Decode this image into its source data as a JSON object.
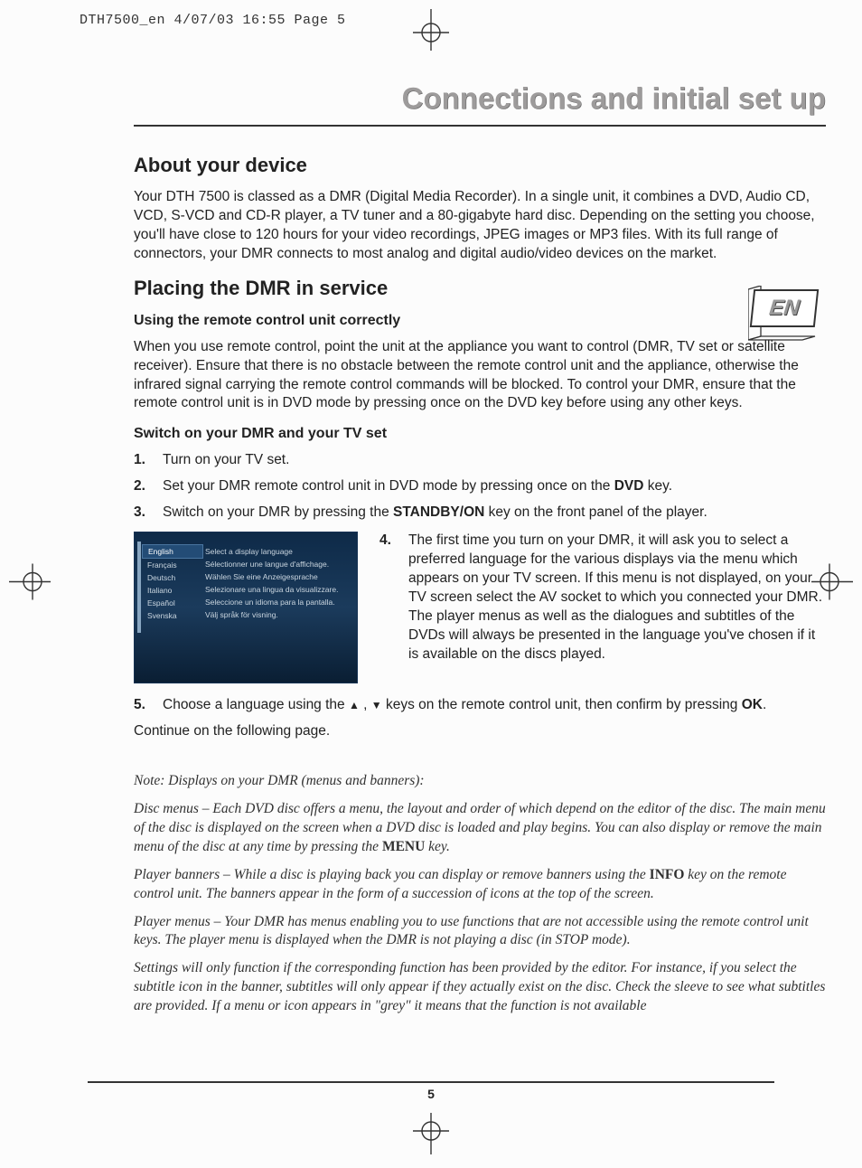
{
  "crop_header": "DTH7500_en  4/07/03  16:55  Page 5",
  "page_title": "Connections and initial set up",
  "lang_badge": "EN",
  "about": {
    "heading": "About your device",
    "body": "Your DTH 7500 is classed as a DMR (Digital Media Recorder). In a single unit, it combines a DVD, Audio CD, VCD, S-VCD and CD-R player, a TV tuner and a 80-gigabyte hard disc. Depending on the setting you choose, you'll have close to 120 hours for your video recordings, JPEG images or MP3 files. With its full range of connectors, your DMR connects to most analog and digital audio/video devices on the market."
  },
  "placing": {
    "heading": "Placing the DMR in service",
    "sub1": "Using the remote control unit correctly",
    "p1": "When you use remote control, point the unit at the appliance you want to control (DMR, TV set or satellite receiver). Ensure that there is no obstacle between the remote control unit and the appliance, otherwise the infrared signal carrying the remote control commands will be blocked. To control your DMR, ensure that the remote control unit is in DVD mode by pressing once on the DVD key before using any other keys.",
    "sub2": "Switch on your DMR and your TV set",
    "steps": {
      "n1": "1.",
      "t1": "Turn on your TV set.",
      "n2": "2.",
      "t2_a": "Set your DMR remote control unit in DVD mode by pressing once on the ",
      "t2_b": "DVD",
      "t2_c": " key.",
      "n3": "3.",
      "t3_a": "Switch on your DMR by pressing the ",
      "t3_b": "STANDBY/ON",
      "t3_c": " key on the front panel of the player.",
      "n4": "4.",
      "t4": "The first time you turn on your DMR, it will ask you to select a preferred language for the various displays via the menu which appears on your TV screen. If this menu is not displayed, on your TV screen select the AV socket to which you connected your DMR. The player menus as well as the dialogues and subtitles of the DVDs will always be presented in the language you've chosen if it is available on the discs played.",
      "n5": "5.",
      "t5_a": "Choose a language using the ",
      "t5_b": " keys on the remote control unit, then confirm by pressing ",
      "t5_c": "OK",
      "t5_d": "."
    },
    "continue": "Continue on the following page."
  },
  "lang_menu": {
    "col1": [
      "English",
      "Français",
      "Deutsch",
      "Italiano",
      "Español",
      "Svenska"
    ],
    "col2": [
      "Select a display language",
      "Sélectionner une langue d'affichage.",
      "Wählen Sie eine Anzeigesprache",
      "Selezionare una lingua da visualizzare.",
      "Seleccione un idioma para la pantalla.",
      "Välj språk för visning."
    ]
  },
  "notes": {
    "heading": "Note: Displays on your DMR (menus and banners):",
    "p1_a": "Disc menus – Each DVD disc offers a menu, the layout and order of which depend on the editor of the disc. The main menu of the disc is displayed on the screen when a DVD disc is loaded and play begins. You can also display or remove the main menu of the disc at any time by pressing the ",
    "p1_b": "MENU",
    "p1_c": " key.",
    "p2_a": "Player banners – While a disc is playing back you can display or remove banners using the ",
    "p2_b": "INFO",
    "p2_c": " key on the remote control unit. The banners appear in the form of a succession of icons at the top of the screen.",
    "p3": "Player menus – Your DMR has menus enabling you to use functions that are not accessible using the remote control unit keys. The player menu is displayed when the DMR is not playing a disc (in STOP mode).",
    "p4": "Settings will only function if the corresponding function has been provided by the editor. For instance, if you select the subtitle icon in the banner, subtitles will only appear if they actually exist on the disc. Check the sleeve to see what subtitles are provided. If a menu or icon appears in \"grey\" it means that the function is not available"
  },
  "page_number": "5"
}
